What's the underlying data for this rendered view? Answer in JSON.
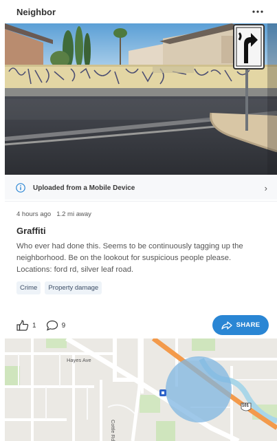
{
  "header": {
    "title": "Neighbor",
    "more_icon": "more-horizontal-icon"
  },
  "photo": {
    "description_icon": "photo"
  },
  "upload": {
    "text": "Uploaded from a Mobile Device",
    "chevron": "›",
    "icon": "info-icon",
    "accent": "#2a86d4"
  },
  "post": {
    "time": "4 hours ago",
    "distance": "1.2 mi away",
    "title": "Graffiti",
    "body": "Who ever had done this. Seems to be continuously tagging up the neighborhood. Be on the lookout for suspicious people please. Locations: ford rd, silver leaf road.",
    "tags": [
      "Crime",
      "Property damage"
    ]
  },
  "actions": {
    "like_count": "1",
    "comment_count": "9",
    "share_label": "SHARE",
    "share_color": "#2a86d4"
  },
  "map": {
    "street_label": "Hayes Ave",
    "street_label_2": "Cottle Rd",
    "highway_shield": "101",
    "radius_color": "#7fb6e2"
  }
}
